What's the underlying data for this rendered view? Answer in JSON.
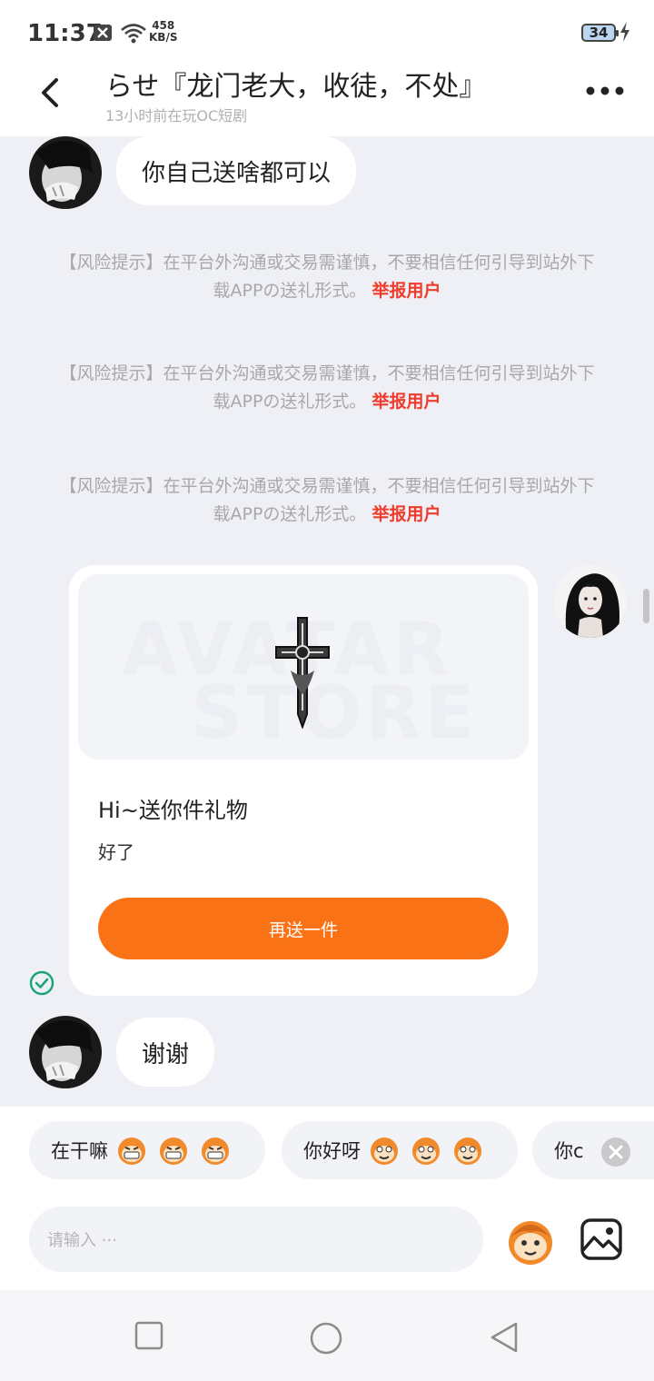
{
  "status_bar": {
    "time": "11:37",
    "net_speed_value": "458",
    "net_speed_unit": "KB/S",
    "battery": "34"
  },
  "header": {
    "title": "らせ『龙门老大，收徒，不处』",
    "subtitle": "13小时前在玩OC短剧"
  },
  "messages": {
    "first_received": "你自己送啥都可以",
    "risk_notice_prefix": "【风险提示】在平台外沟通或交易需谨慎，不要相信任何引导到站外下载APPの送礼形式。",
    "risk_notice_link": "举报用户",
    "gift_card": {
      "watermark_line1": "AVATAR",
      "watermark_line2": "STORE",
      "title": "Hi~送你件礼物",
      "message": "好了",
      "button_label": "再送一件"
    },
    "last_received": "谢谢"
  },
  "quick_replies": [
    {
      "label": "在干嘛"
    },
    {
      "label": "你好呀"
    },
    {
      "label": "你c"
    }
  ],
  "input": {
    "placeholder": "请输入 ···"
  },
  "colors": {
    "accent_orange": "#f97316",
    "report_red": "#ef3b2c",
    "sent_check_green": "#1aa37a"
  }
}
